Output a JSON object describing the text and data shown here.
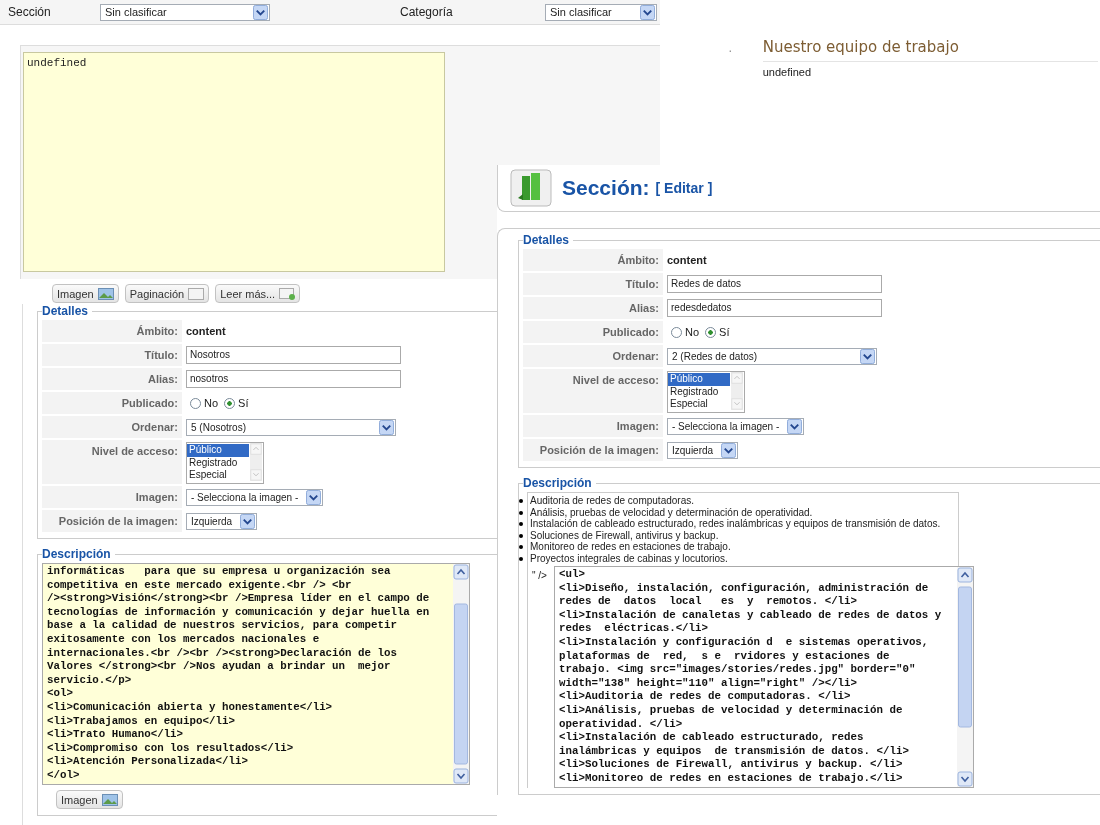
{
  "top_form": {
    "section_label": "Sección",
    "section_value": "Sin clasificar",
    "category_label": "Categoría",
    "category_value": "Sin clasificar",
    "editor_text": "undefined",
    "buttons": [
      {
        "label": "Imagen"
      },
      {
        "label": "Paginación"
      },
      {
        "label": "Leer más..."
      }
    ]
  },
  "blog": {
    "bullet": "·",
    "title": "Nuestro equipo de trabajo",
    "body": "undefined"
  },
  "panels": [
    {
      "details": {
        "legend": "Detalles",
        "rows": [
          {
            "kind": "static",
            "label": "Ámbito:",
            "value": "content"
          },
          {
            "kind": "input",
            "label": "Título:",
            "value": "Nosotros"
          },
          {
            "kind": "input",
            "label": "Alias:",
            "value": "nosotros"
          },
          {
            "kind": "radio",
            "label": "Publicado:",
            "options": [
              {
                "label": "No",
                "selected": false
              },
              {
                "label": "Sí",
                "selected": true
              }
            ]
          },
          {
            "kind": "wide_select",
            "label": "Ordenar:",
            "value": "5 (Nosotros)"
          },
          {
            "kind": "listbox",
            "label": "Nivel de acceso:",
            "options": [
              {
                "label": "Público",
                "selected": true
              },
              {
                "label": "Registrado",
                "selected": false
              },
              {
                "label": "Especial",
                "selected": false
              }
            ]
          },
          {
            "kind": "select",
            "label": "Imagen:",
            "value": "- Selecciona la imagen -"
          },
          {
            "kind": "select",
            "label": "Posición de la imagen:",
            "value": "Izquierda"
          }
        ]
      },
      "description": {
        "legend": "Descripción",
        "lines": [
          "informáticas   para que su empresa u organización sea",
          "competitiva en este mercado exigente.<br /> <br",
          "/><strong>Visión</strong><br />Empresa líder en el campo de",
          "tecnologías de información y comunicación y dejar huella en",
          "base a la calidad de nuestros servicios, para competir",
          "exitosamente con los mercados nacionales e",
          "internacionales.<br /><br /><strong>Declaración de los",
          "Valores </strong><br />Nos ayudan a brindar un  mejor",
          "servicio.</p>",
          "<ol>",
          "<li>Comunicación abierta y honestamente</li>",
          "<li>Trabajamos en equipo</li>",
          "<li>Trato Humano</li>",
          "<li>Compromiso con los resultados</li>",
          "<li>Atención Personalizada</li>",
          "</ol>"
        ],
        "buttons": [
          {
            "label": "Imagen"
          }
        ]
      }
    },
    {
      "header": {
        "title": "Sección:",
        "action": "[ Editar ]"
      },
      "details": {
        "legend": "Detalles",
        "rows": [
          {
            "kind": "static",
            "label": "Ámbito:",
            "value": "content"
          },
          {
            "kind": "input",
            "label": "Título:",
            "value": "Redes de datos"
          },
          {
            "kind": "input",
            "label": "Alias:",
            "value": "redesdedatos"
          },
          {
            "kind": "radio",
            "label": "Publicado:",
            "options": [
              {
                "label": "No",
                "selected": false
              },
              {
                "label": "Sí",
                "selected": true
              }
            ]
          },
          {
            "kind": "wide_select",
            "label": "Ordenar:",
            "value": "2 (Redes de datos)"
          },
          {
            "kind": "listbox",
            "label": "Nivel de acceso:",
            "options": [
              {
                "label": "Público",
                "selected": true
              },
              {
                "label": "Registrado",
                "selected": false
              },
              {
                "label": "Especial",
                "selected": false
              }
            ]
          },
          {
            "kind": "select",
            "label": "Imagen:",
            "value": "- Selecciona la imagen -"
          },
          {
            "kind": "select",
            "label": "Posición de la imagen:",
            "value": "Izquierda"
          }
        ]
      },
      "description": {
        "legend": "Descripción",
        "preview": [
          "Auditoria de redes de computadoras.",
          "Análisis, pruebas de velocidad y determinación de operatividad.",
          "Instalación de cableado estructurado, redes inalámbricas y equipos de transmisión de datos.",
          "Soluciones de Firewall, antivirus y backup.",
          "Monitoreo de redes en estaciones de trabajo.",
          "Proyectos integrales de cabinas y locutorios."
        ],
        "prefix": "\" />",
        "lines": [
          "<ul>",
          "<li>Diseño, instalación, configuración, administración de",
          "redes de  datos  local   es  y  remotos. </li>",
          "<li>Instalación de canaletas y cableado de redes de datos y",
          "redes  eléctricas.</li>",
          "<li>Instalación y configuración d  e sistemas operativos,",
          "plataformas de  red,  s e  rvidores y estaciones de",
          "trabajo. <img src=\"images/stories/redes.jpg\" border=\"0\"",
          "width=\"138\" height=\"110\" align=\"right\" /></li>",
          "<li>Auditoria de redes de computadoras. </li>",
          "<li>Análisis, pruebas de velocidad y determinación de",
          "operatividad. </li>",
          "<li>Instalación de cableado estructurado, redes",
          "inalámbricas y equipos  de transmisión de datos. </li>",
          "<li>Soluciones de Firewall, antivirus y backup. </li>",
          "<li>Monitoreo de redes en estaciones de trabajo.</li>"
        ]
      }
    }
  ]
}
